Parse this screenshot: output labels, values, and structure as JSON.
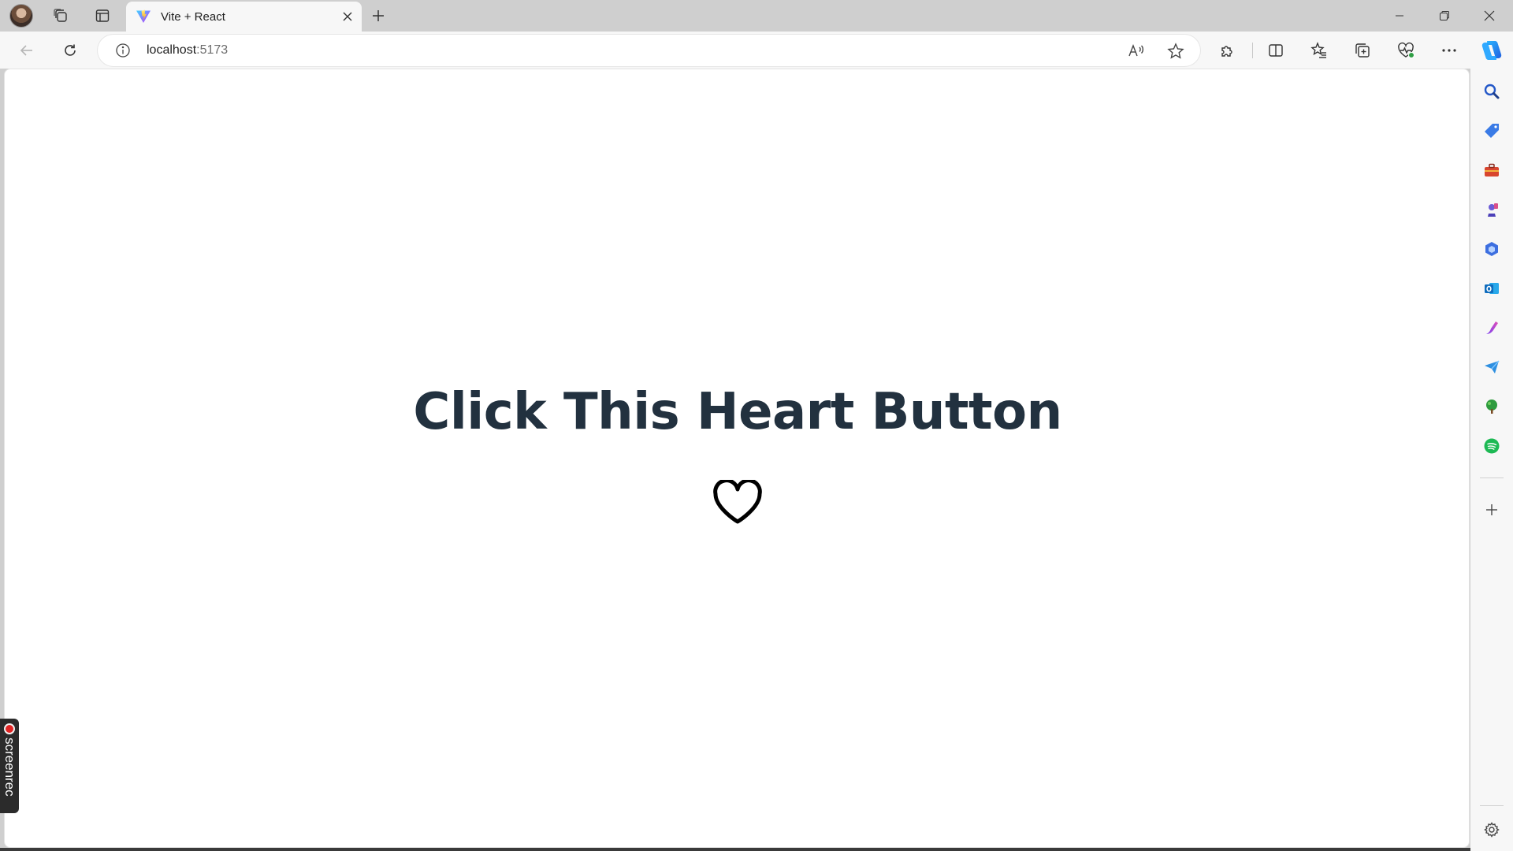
{
  "browser": {
    "tab": {
      "title": "Vite + React",
      "favicon": "vite-logo-icon"
    },
    "address": {
      "host": "localhost",
      "port": ":5173"
    },
    "icons": {
      "profile": "avatar",
      "workspaces": "workspaces-icon",
      "vertical_tabs": "tab-actions-icon",
      "close_tab": "close-icon",
      "new_tab": "plus-icon",
      "back": "back-arrow-icon",
      "refresh": "refresh-icon",
      "site_info": "info-icon",
      "read_aloud": "read-aloud-icon",
      "favorite": "star-icon",
      "extensions": "puzzle-icon",
      "split_screen": "split-screen-icon",
      "favorites": "favorites-list-icon",
      "collections": "collections-icon",
      "browser_essentials": "heart-pulse-icon",
      "more": "more-icon",
      "copilot": "copilot-icon"
    },
    "sidebar": [
      {
        "name": "search-icon",
        "color": "#1a73e8"
      },
      {
        "name": "shopping-tag-icon",
        "color": "#2f6fe0"
      },
      {
        "name": "tools-briefcase-icon",
        "color": "#d8452e"
      },
      {
        "name": "games-icon",
        "color": "#6b5bd6"
      },
      {
        "name": "microsoft365-icon",
        "color": "#3d6fe0"
      },
      {
        "name": "outlook-icon",
        "color": "#0f6cbd"
      },
      {
        "name": "designer-icon",
        "color": "#a64bd9"
      },
      {
        "name": "send-icon",
        "color": "#2e8fe0"
      },
      {
        "name": "tree-icon",
        "color": "#2e9b3e"
      },
      {
        "name": "spotify-icon",
        "color": "#1db954"
      }
    ]
  },
  "page": {
    "heading": "Click This Heart Button",
    "heart_button_icon": "heart-outline-icon"
  },
  "overlay": {
    "screenrec_label": "screenrec"
  },
  "colors": {
    "heading": "#22313f",
    "heart_stroke": "#000000"
  }
}
